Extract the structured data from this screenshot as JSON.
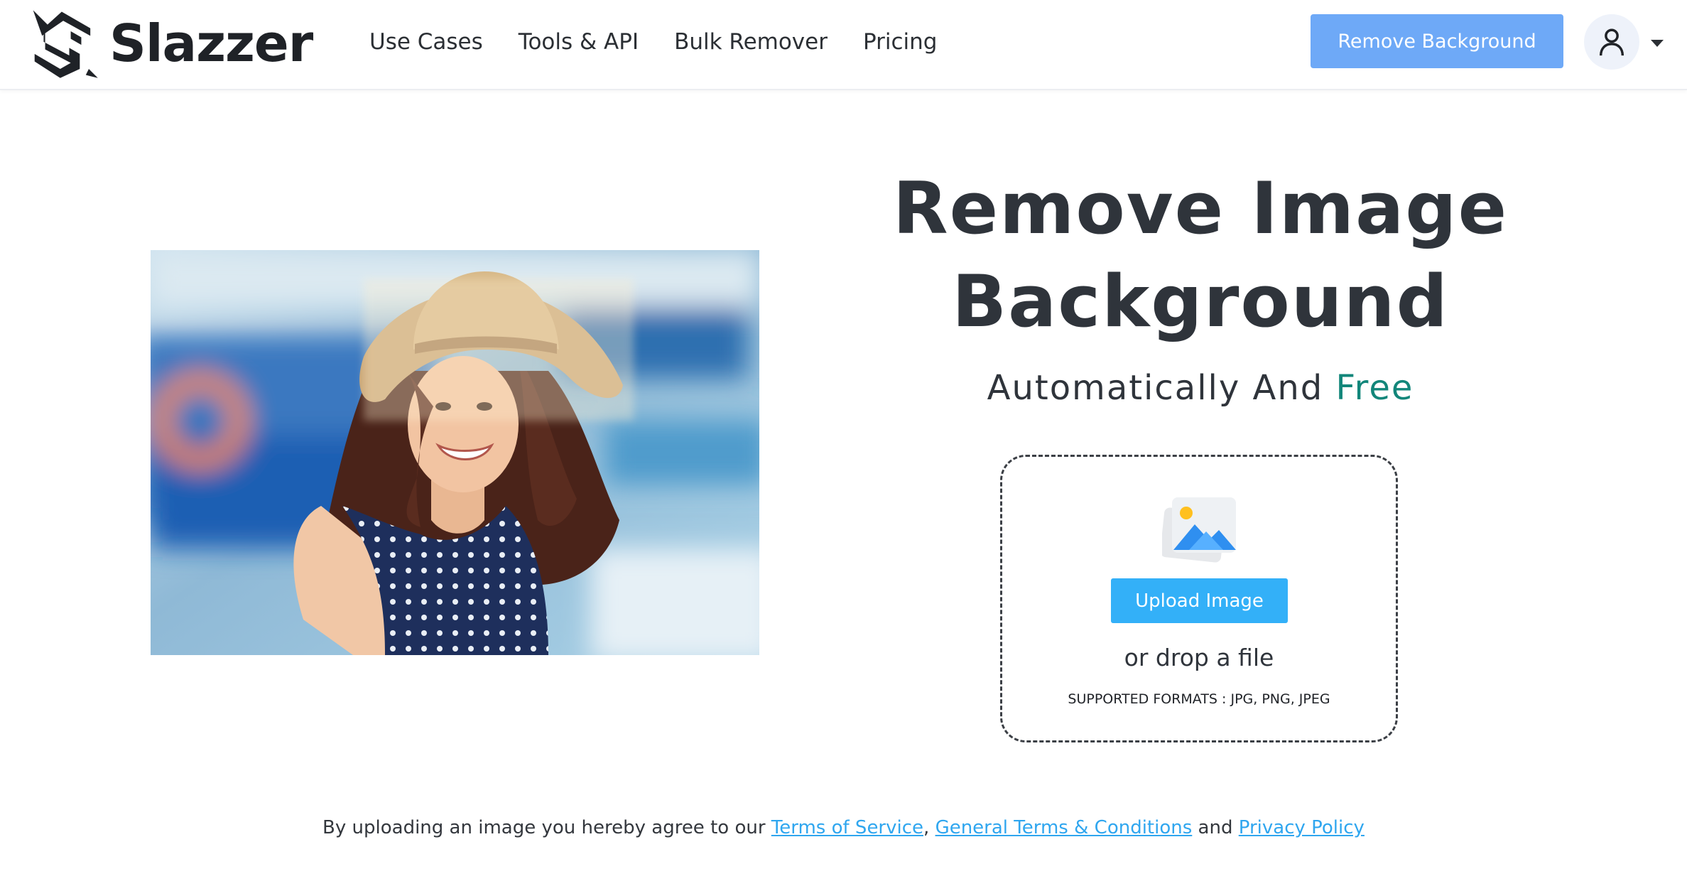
{
  "brand": {
    "name": "Slazzer",
    "logo_icon": "slazzer-logo-icon"
  },
  "nav": {
    "items": [
      {
        "label": "Use Cases"
      },
      {
        "label": "Tools & API"
      },
      {
        "label": "Bulk Remover"
      },
      {
        "label": "Pricing"
      }
    ]
  },
  "header": {
    "cta_label": "Remove Background",
    "account_icon": "user-icon",
    "dropdown_icon": "caret-down-icon"
  },
  "hero": {
    "title_line1": "Remove Image",
    "title_line2": "Background",
    "subtitle_prefix": "Automatically And ",
    "subtitle_accent": "Free",
    "accent_color": "#12867a"
  },
  "upload": {
    "illustration_icon": "image-placeholder-icon",
    "button_label": "Upload Image",
    "drop_text": "or drop a file",
    "formats_text": "SUPPORTED FORMATS : JPG, PNG, JPEG"
  },
  "legal": {
    "prefix": "By uploading an image you hereby agree to our ",
    "terms_label": "Terms of Service",
    "separator": ",",
    "general_terms_label": "General Terms & Conditions",
    "and_text": " and ",
    "privacy_label": "Privacy Policy"
  },
  "colors": {
    "header_cta": "#6ea9f7",
    "upload_button": "#33b0f8",
    "link": "#2fa6ef",
    "heading": "#2f343b"
  }
}
